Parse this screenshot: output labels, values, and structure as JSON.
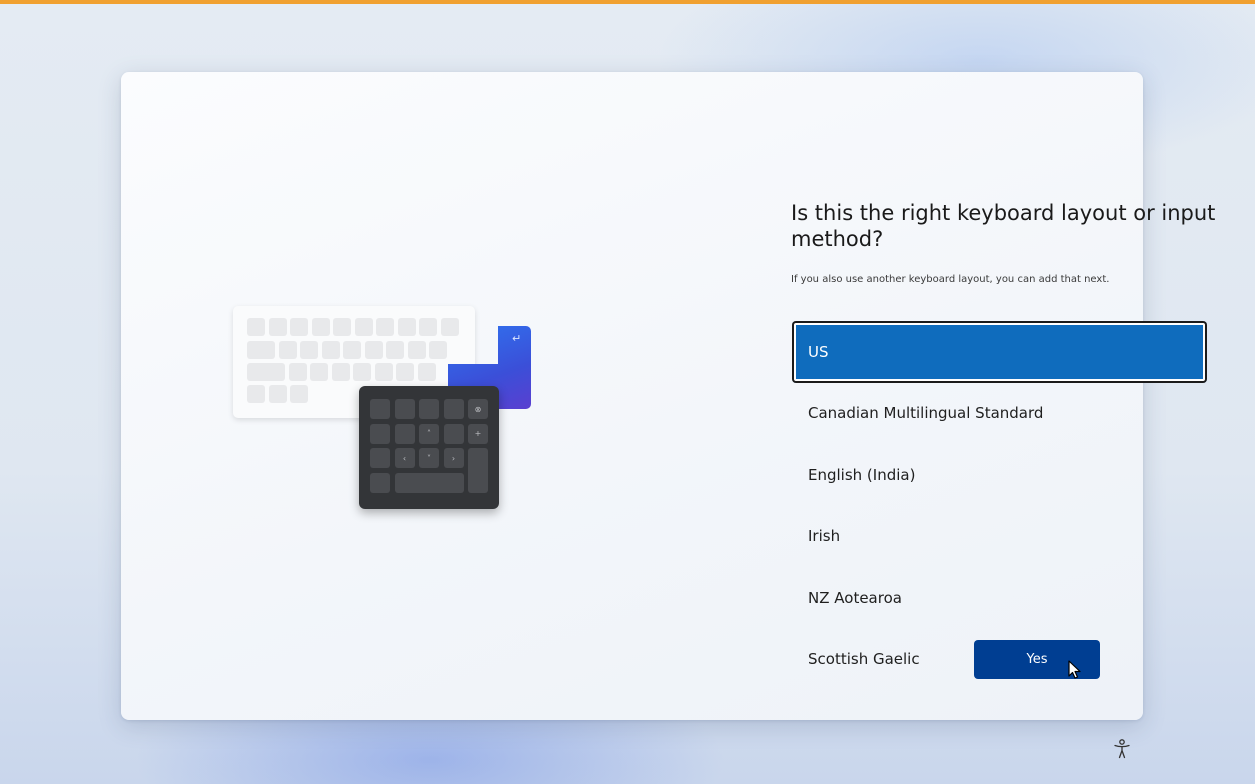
{
  "colors": {
    "accent": "#0f6cbd",
    "primary_button": "#003e92",
    "top_strip": "#f0a030"
  },
  "page": {
    "heading": "Is this the right keyboard layout or input method?",
    "subtext": "If you also use another keyboard layout, you can add that next."
  },
  "layouts": {
    "selected_index": 0,
    "items": [
      {
        "label": "US"
      },
      {
        "label": "Canadian Multilingual Standard"
      },
      {
        "label": "English (India)"
      },
      {
        "label": "Irish"
      },
      {
        "label": "NZ Aotearoa"
      },
      {
        "label": "Scottish Gaelic"
      }
    ]
  },
  "actions": {
    "yes_label": "Yes"
  },
  "icons": {
    "illustration": "keyboard-illustration",
    "accessibility": "accessibility-icon",
    "cursor": "mouse-pointer-icon"
  }
}
